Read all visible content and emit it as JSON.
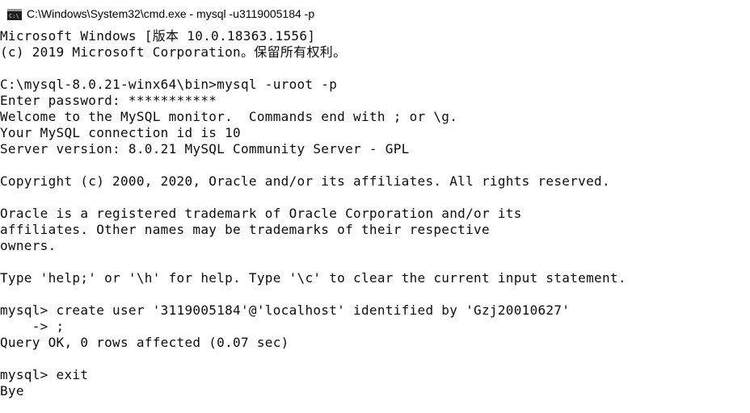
{
  "window": {
    "title": "C:\\Windows\\System32\\cmd.exe - mysql  -u3119005184 -p",
    "icon": "cmd-icon"
  },
  "console": {
    "lines": [
      "Microsoft Windows [版本 10.0.18363.1556]",
      "(c) 2019 Microsoft Corporation。保留所有权利。",
      "",
      "C:\\mysql-8.0.21-winx64\\bin>mysql -uroot -p",
      "Enter password: ***********",
      "Welcome to the MySQL monitor.  Commands end with ; or \\g.",
      "Your MySQL connection id is 10",
      "Server version: 8.0.21 MySQL Community Server - GPL",
      "",
      "Copyright (c) 2000, 2020, Oracle and/or its affiliates. All rights reserved.",
      "",
      "Oracle is a registered trademark of Oracle Corporation and/or its",
      "affiliates. Other names may be trademarks of their respective",
      "owners.",
      "",
      "Type 'help;' or '\\h' for help. Type '\\c' to clear the current input statement.",
      "",
      "mysql> create user '3119005184'@'localhost' identified by 'Gzj20010627'",
      "    -> ;",
      "Query OK, 0 rows affected (0.07 sec)",
      "",
      "mysql> exit",
      "Bye"
    ]
  },
  "colors": {
    "background": "#ffffff",
    "text": "#0c0c0c"
  }
}
